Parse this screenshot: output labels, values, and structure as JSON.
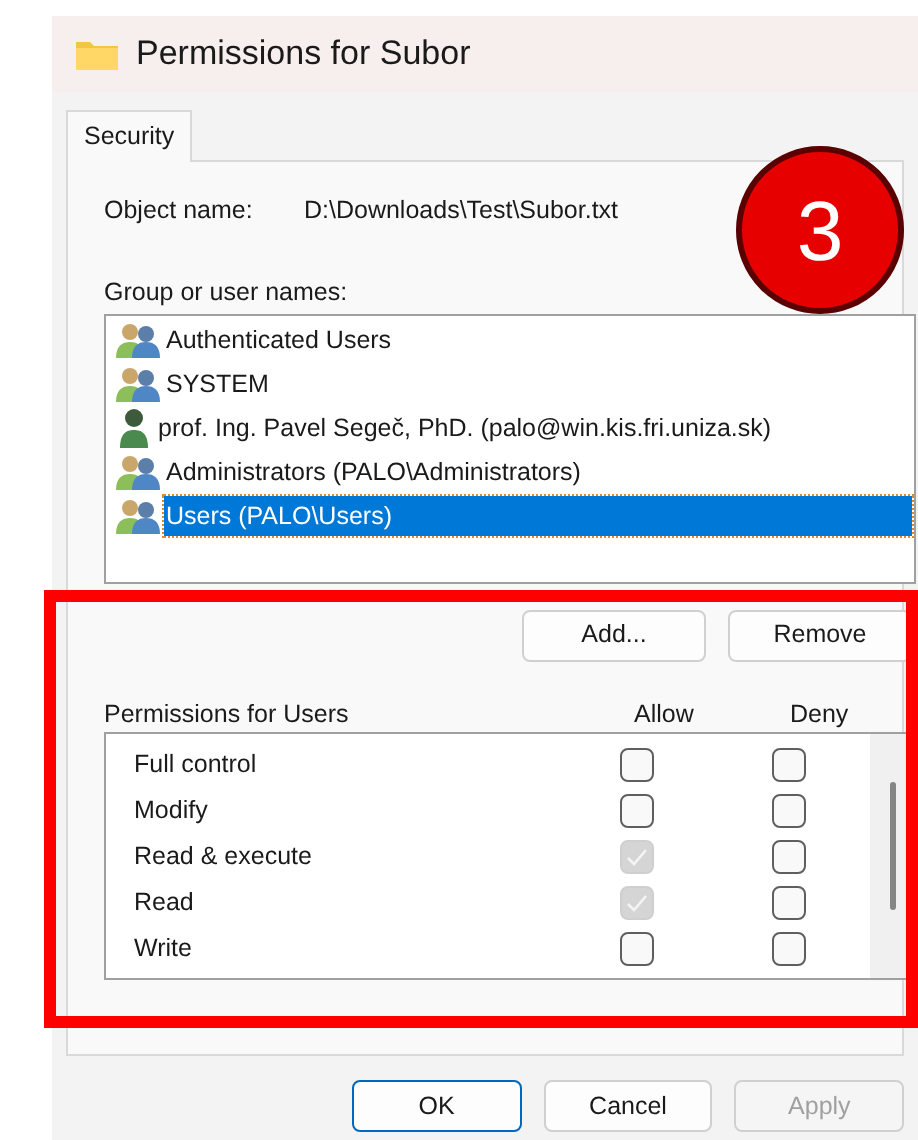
{
  "window": {
    "title": "Permissions for Subor"
  },
  "tabs": [
    {
      "label": "Security",
      "selected": true
    }
  ],
  "object_name": {
    "label": "Object name:",
    "value": "D:\\Downloads\\Test\\Subor.txt"
  },
  "group_label": "Group or user names:",
  "principals": [
    {
      "name": "Authenticated Users",
      "kind": "group",
      "selected": false
    },
    {
      "name": "SYSTEM",
      "kind": "group",
      "selected": false
    },
    {
      "name": "prof. Ing. Pavel Segeč, PhD. (palo@win.kis.fri.uniza.sk)",
      "kind": "user",
      "selected": false
    },
    {
      "name": "Administrators (PALO\\Administrators)",
      "kind": "group",
      "selected": false
    },
    {
      "name": "Users (PALO\\Users)",
      "kind": "group",
      "selected": true
    }
  ],
  "list_buttons": [
    {
      "label": "Add..."
    },
    {
      "label": "Remove"
    }
  ],
  "permissions": {
    "title": "Permissions for Users",
    "allow_header": "Allow",
    "deny_header": "Deny",
    "rows": [
      {
        "name": "Full control",
        "allow": {
          "checked": false,
          "disabled": false
        },
        "deny": {
          "checked": false,
          "disabled": false
        }
      },
      {
        "name": "Modify",
        "allow": {
          "checked": false,
          "disabled": false
        },
        "deny": {
          "checked": false,
          "disabled": false
        }
      },
      {
        "name": "Read & execute",
        "allow": {
          "checked": true,
          "disabled": true
        },
        "deny": {
          "checked": false,
          "disabled": false
        }
      },
      {
        "name": "Read",
        "allow": {
          "checked": true,
          "disabled": true
        },
        "deny": {
          "checked": false,
          "disabled": false
        }
      },
      {
        "name": "Write",
        "allow": {
          "checked": false,
          "disabled": false
        },
        "deny": {
          "checked": false,
          "disabled": false
        }
      }
    ]
  },
  "dialog_buttons": [
    {
      "label": "OK",
      "kind": "default",
      "disabled": false
    },
    {
      "label": "Cancel",
      "kind": "normal",
      "disabled": false
    },
    {
      "label": "Apply",
      "kind": "normal",
      "disabled": true
    }
  ],
  "callout": {
    "number": "3"
  }
}
